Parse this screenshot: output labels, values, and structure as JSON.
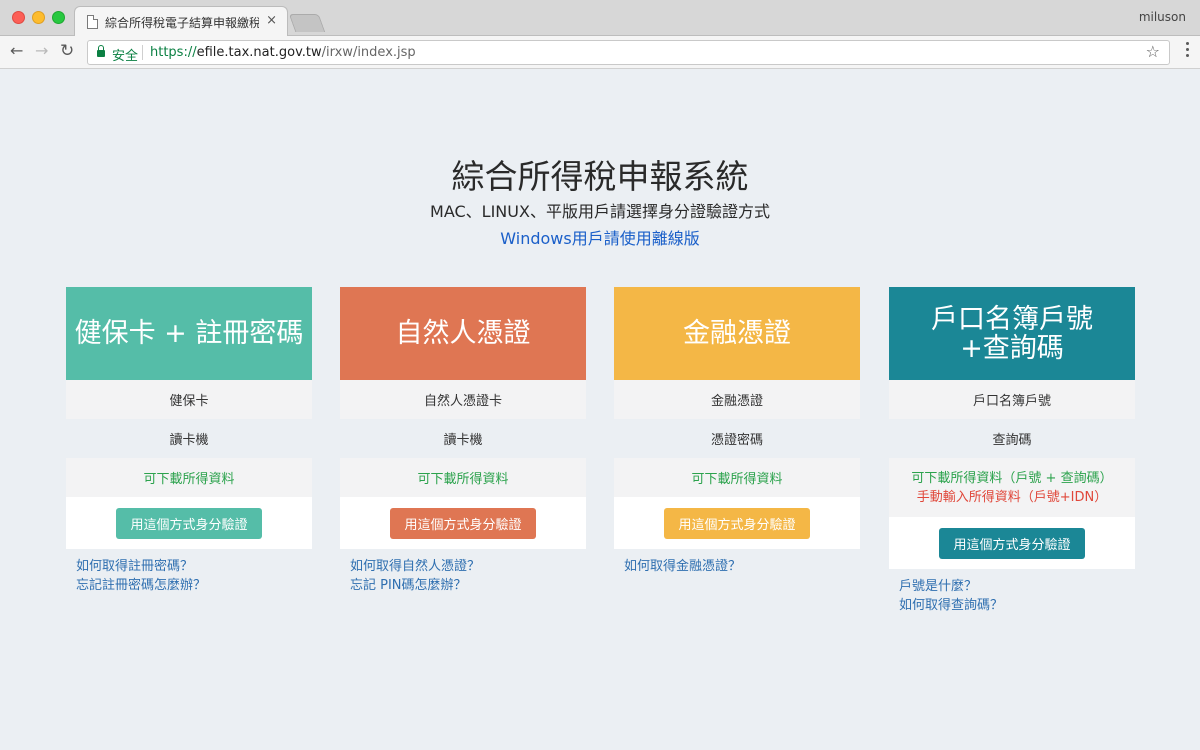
{
  "browser": {
    "tab_title": "綜合所得稅電子結算申報繳稅系統",
    "tab_close": "×",
    "profile_name": "miluson",
    "secure_label": "安全",
    "url_scheme": "https://",
    "url_host": "efile.tax.nat.gov.tw",
    "url_path": "/irxw/index.jsp",
    "icons": {
      "back": "arrow-left-icon",
      "forward": "arrow-right-icon",
      "reload": "reload-icon",
      "lock": "lock-icon",
      "star": "star-icon",
      "menu": "menu-dots-icon"
    }
  },
  "header": {
    "title": "綜合所得稅申報系統",
    "subtitle": "MAC、LINUX、平版用戶請選擇身分證驗證方式",
    "offline_link": "Windows用戶請使用離線版"
  },
  "colors": {
    "teal": "#55bda8",
    "orange": "#df7653",
    "yellow": "#f4b746",
    "darkteal": "#1b8796",
    "green_text": "#2ba24c",
    "red_text": "#e0473a",
    "link": "#2f6fb0"
  },
  "cards": [
    {
      "title": "健保卡 + 註冊密碼",
      "item1": "健保卡",
      "item2": "讀卡機",
      "status": "可下載所得資料",
      "button": "用這個方式身分驗證",
      "links": [
        "如何取得註冊密碼？",
        "忘記註冊密碼怎麼辦？"
      ]
    },
    {
      "title": "自然人憑證",
      "item1": "自然人憑證卡",
      "item2": "讀卡機",
      "status": "可下載所得資料",
      "button": "用這個方式身分驗證",
      "links": [
        "如何取得自然人憑證？",
        "忘記 PIN碼怎麼辦？"
      ]
    },
    {
      "title": "金融憑證",
      "item1": "金融憑證",
      "item2": "憑證密碼",
      "status": "可下載所得資料",
      "button": "用這個方式身分驗證",
      "links": [
        "如何取得金融憑證？"
      ]
    },
    {
      "title_line1": "戶口名簿戶號",
      "title_line2": "+查詢碼",
      "item1": "戶口名簿戶號",
      "item2": "查詢碼",
      "status": "可下載所得資料（戶號 + 查詢碼）",
      "status_manual": "手動輸入所得資料（戶號+IDN）",
      "button": "用這個方式身分驗證",
      "links": [
        "戶號是什麼？",
        "如何取得查詢碼？"
      ]
    }
  ]
}
